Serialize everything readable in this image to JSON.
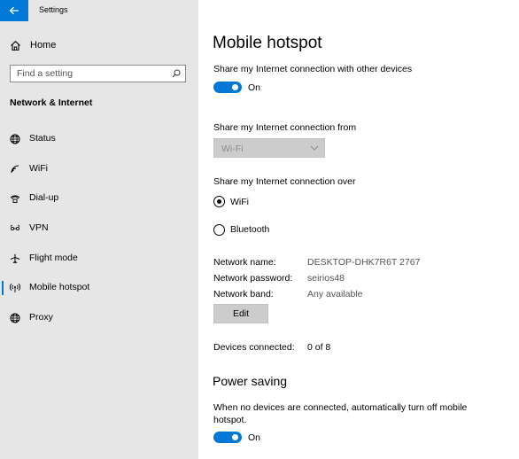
{
  "app": {
    "title": "Settings"
  },
  "sidebar": {
    "home_label": "Home",
    "search_placeholder": "Find a setting",
    "section_title": "Network & Internet",
    "items": [
      {
        "label": "Status",
        "icon": "globe-icon"
      },
      {
        "label": "WiFi",
        "icon": "wifi-icon"
      },
      {
        "label": "Dial-up",
        "icon": "phone-icon"
      },
      {
        "label": "VPN",
        "icon": "vpn-icon"
      },
      {
        "label": "Flight mode",
        "icon": "airplane-icon"
      },
      {
        "label": "Mobile hotspot",
        "icon": "hotspot-icon",
        "active": true
      },
      {
        "label": "Proxy",
        "icon": "globe-icon"
      }
    ]
  },
  "main": {
    "title": "Mobile hotspot",
    "share_label": "Share my Internet connection with other devices",
    "share_toggle_state": "On",
    "share_from_label": "Share my Internet connection from",
    "share_from_value": "Wi-Fi",
    "share_over_label": "Share my Internet connection over",
    "share_over_options": [
      "WiFi",
      "Bluetooth"
    ],
    "share_over_selected": "WiFi",
    "network_name_label": "Network name:",
    "network_name_value": "DESKTOP-DHK7R6T 2767",
    "network_password_label": "Network password:",
    "network_password_value": "seirios48",
    "network_band_label": "Network band:",
    "network_band_value": "Any available",
    "edit_label": "Edit",
    "devices_label": "Devices connected:",
    "devices_value": "0 of 8",
    "power_title": "Power saving",
    "power_desc": "When no devices are connected, automatically turn off mobile hotspot.",
    "power_toggle_state": "On"
  },
  "colors": {
    "accent": "#0078d7",
    "sidebar_bg": "#e6e6e6"
  }
}
